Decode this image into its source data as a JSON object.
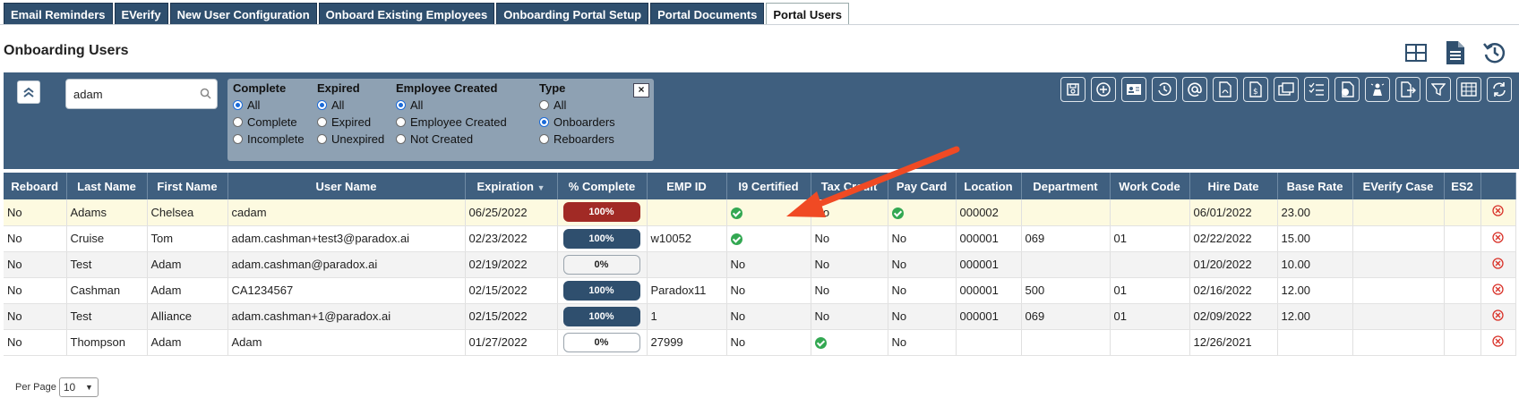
{
  "tabs": [
    {
      "label": "Email Reminders"
    },
    {
      "label": "EVerify"
    },
    {
      "label": "New User Configuration"
    },
    {
      "label": "Onboard Existing Employees"
    },
    {
      "label": "Onboarding Portal Setup"
    },
    {
      "label": "Portal Documents"
    },
    {
      "label": "Portal Users"
    }
  ],
  "active_tab": "Portal Users",
  "page_title": "Onboarding Users",
  "search": {
    "value": "adam"
  },
  "filters": {
    "complete": {
      "title": "Complete",
      "options": [
        "All",
        "Complete",
        "Incomplete"
      ],
      "selected": "All"
    },
    "expired": {
      "title": "Expired",
      "options": [
        "All",
        "Expired",
        "Unexpired"
      ],
      "selected": "All"
    },
    "employee_created": {
      "title": "Employee Created",
      "options": [
        "All",
        "Employee Created",
        "Not Created"
      ],
      "selected": "All"
    },
    "type": {
      "title": "Type",
      "options": [
        "All",
        "Onboarders",
        "Reboarders"
      ],
      "selected": "Onboarders"
    },
    "close_label": "×"
  },
  "table": {
    "columns": [
      "Reboard",
      "Last Name",
      "First Name",
      "User Name",
      "Expiration",
      "% Complete",
      "EMP ID",
      "I9 Certified",
      "Tax Credit",
      "Pay Card",
      "Location",
      "Department",
      "Work Code",
      "Hire Date",
      "Base Rate",
      "EVerify Case",
      "ES2",
      ""
    ],
    "sort_indicator": "▼",
    "rows": [
      {
        "reboard": "No",
        "last": "Adams",
        "first": "Chelsea",
        "user": "cadam",
        "exp": "06/25/2022",
        "pct": "100%",
        "empid": "",
        "i9": "check",
        "tax": "No",
        "pay": "check",
        "loc": "000002",
        "dept": "",
        "work": "",
        "hire": "06/01/2022",
        "rate": "23.00",
        "everify": "",
        "es2": ""
      },
      {
        "reboard": "No",
        "last": "Cruise",
        "first": "Tom",
        "user": "adam.cashman+test3@paradox.ai",
        "exp": "02/23/2022",
        "pct": "100%",
        "empid": "w10052",
        "i9": "check",
        "tax": "No",
        "pay": "No",
        "loc": "000001",
        "dept": "069",
        "work": "01",
        "hire": "02/22/2022",
        "rate": "15.00",
        "everify": "",
        "es2": ""
      },
      {
        "reboard": "No",
        "last": "Test",
        "first": "Adam",
        "user": "adam.cashman@paradox.ai",
        "exp": "02/19/2022",
        "pct": "0%",
        "empid": "",
        "i9": "No",
        "tax": "No",
        "pay": "No",
        "loc": "000001",
        "dept": "",
        "work": "",
        "hire": "01/20/2022",
        "rate": "10.00",
        "everify": "",
        "es2": ""
      },
      {
        "reboard": "No",
        "last": "Cashman",
        "first": "Adam",
        "user": "CA1234567",
        "exp": "02/15/2022",
        "pct": "100%",
        "empid": "Paradox11",
        "i9": "No",
        "tax": "No",
        "pay": "No",
        "loc": "000001",
        "dept": "500",
        "work": "01",
        "hire": "02/16/2022",
        "rate": "12.00",
        "everify": "",
        "es2": ""
      },
      {
        "reboard": "No",
        "last": "Test",
        "first": "Alliance",
        "user": "adam.cashman+1@paradox.ai",
        "exp": "02/15/2022",
        "pct": "100%",
        "empid": "1",
        "i9": "No",
        "tax": "No",
        "pay": "No",
        "loc": "000001",
        "dept": "069",
        "work": "01",
        "hire": "02/09/2022",
        "rate": "12.00",
        "everify": "",
        "es2": ""
      },
      {
        "reboard": "No",
        "last": "Thompson",
        "first": "Adam",
        "user": "Adam",
        "exp": "01/27/2022",
        "pct": "0%",
        "empid": "27999",
        "i9": "No",
        "tax": "check",
        "pay": "No",
        "loc": "",
        "dept": "",
        "work": "",
        "hire": "12/26/2021",
        "rate": "",
        "everify": "",
        "es2": ""
      }
    ]
  },
  "per_page": {
    "label": "Per Page",
    "value": "10"
  },
  "colors": {
    "header": "#3f5f7f",
    "tab": "#2f4f6e",
    "progress_full": "#2f4f6e",
    "progress_highlight": "#a12a25",
    "check": "#33a852",
    "delete": "#d9342b",
    "arrow": "#f04a24"
  },
  "icons": {
    "top": [
      "grid-layout-icon",
      "document-icon",
      "history-icon"
    ],
    "toolbar": [
      "save-icon",
      "add-icon",
      "user-card-icon",
      "history-icon",
      "at-icon",
      "pdf-icon",
      "document-dollar-icon",
      "copy-folder-icon",
      "checklist-icon",
      "document-refresh-icon",
      "person-highlight-icon",
      "export-icon",
      "filter-icon",
      "table-icon",
      "refresh-icon"
    ]
  }
}
